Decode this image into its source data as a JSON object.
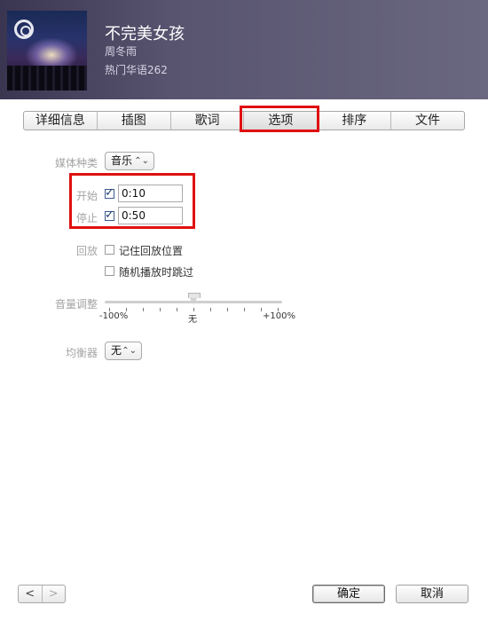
{
  "song": {
    "title": "不完美女孩",
    "artist": "周冬雨",
    "album": "热门华语262"
  },
  "tabs": [
    {
      "label": "详细信息"
    },
    {
      "label": "插图"
    },
    {
      "label": "歌词"
    },
    {
      "label": "选项",
      "active": true
    },
    {
      "label": "排序"
    },
    {
      "label": "文件"
    }
  ],
  "media_kind": {
    "label": "媒体种类",
    "value": "音乐"
  },
  "start": {
    "label": "开始",
    "checked": true,
    "value": "0:10"
  },
  "stop": {
    "label": "停止",
    "checked": true,
    "value": "0:50"
  },
  "playback": {
    "label": "回放",
    "remember_position": {
      "label": "记住回放位置",
      "checked": false
    },
    "skip_when_shuffling": {
      "label": "随机播放时跳过",
      "checked": false
    }
  },
  "volume": {
    "label": "音量调整",
    "min_label": "-100%",
    "mid_label": "无",
    "max_label": "+100%",
    "value_percent": 0
  },
  "equalizer": {
    "label": "均衡器",
    "value": "无"
  },
  "footer": {
    "prev_icon": "chevron-left",
    "next_icon": "chevron-right",
    "ok_label": "确定",
    "cancel_label": "取消"
  },
  "colors": {
    "highlight": "#e01010",
    "header_bg": "#585470"
  }
}
